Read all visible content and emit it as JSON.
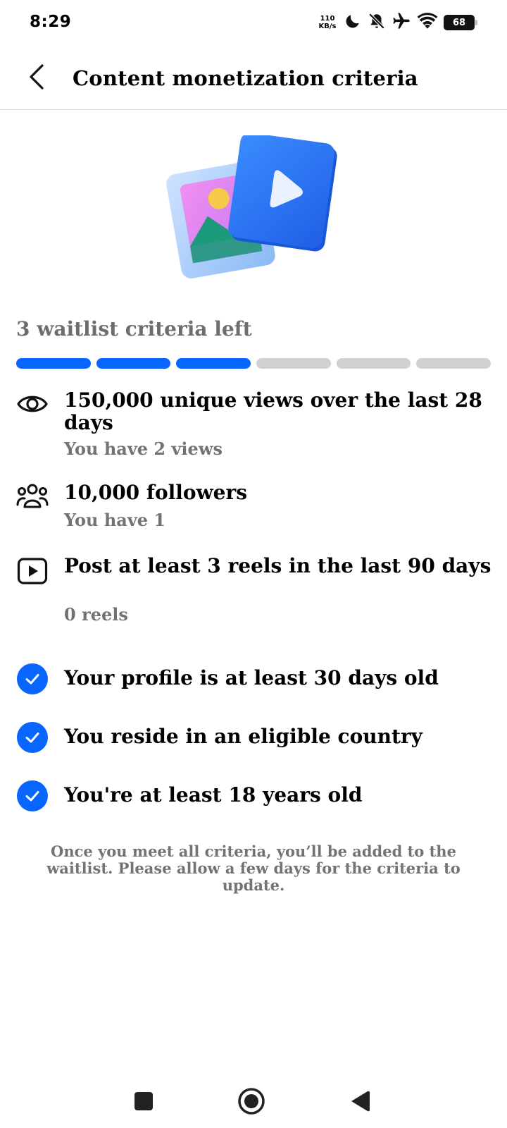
{
  "status_bar": {
    "time": "8:29",
    "net_speed_value": "110",
    "net_speed_unit": "KB/s",
    "battery": "68",
    "icons": [
      "moon-icon",
      "bell-off-icon",
      "airplane-icon",
      "wifi-icon",
      "battery-icon"
    ]
  },
  "header": {
    "title": "Content monetization criteria",
    "back_icon": "chevron-left-icon"
  },
  "progress": {
    "label": "3 waitlist criteria left",
    "total_segments": 6,
    "completed_segments": 3,
    "accent_color": "#0866ff",
    "inactive_color": "#d1d1d1"
  },
  "criteria": [
    {
      "icon": "eye-icon",
      "title": "150,000 unique views over the last 28 days",
      "subtitle": "You have 2 views",
      "met": false
    },
    {
      "icon": "people-icon",
      "title": "10,000 followers",
      "subtitle": "You have 1",
      "met": false
    },
    {
      "icon": "reels-icon",
      "title": "Post at least 3 reels in the last 90 days",
      "subtitle": "0 reels",
      "met": false
    },
    {
      "icon": "check-circle-icon",
      "title": "Your profile is at least 30 days old",
      "met": true
    },
    {
      "icon": "check-circle-icon",
      "title": "You reside in an eligible country",
      "met": true
    },
    {
      "icon": "check-circle-icon",
      "title": "You're at least 18 years old",
      "met": true
    }
  ],
  "footnote": "Once you meet all criteria, you’ll be added to the waitlist. Please allow a few days for the criteria to update.",
  "nav_bar": {
    "buttons": [
      "recents-button",
      "home-button",
      "back-button"
    ]
  }
}
